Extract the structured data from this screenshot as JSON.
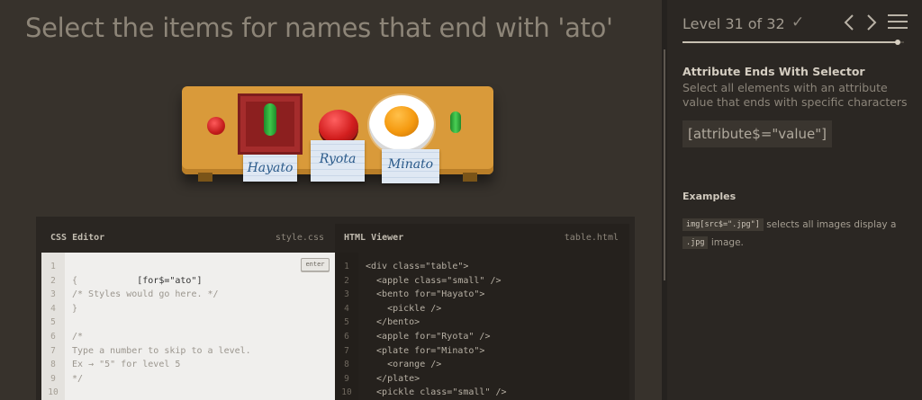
{
  "instruction": "Select the items for names that end with 'ato'",
  "table": {
    "name_tags": [
      "Hayato",
      "Ryota",
      "Minato"
    ]
  },
  "css_editor": {
    "title": "CSS Editor",
    "filename": "style.css",
    "enter_label": "enter",
    "input_value": "[for$=\"ato\"]",
    "line_numbers": [
      "1",
      "2",
      "3",
      "4",
      "5",
      "6",
      "7",
      "8",
      "9",
      "10"
    ],
    "lines": [
      "{",
      "/* Styles would go here. */",
      "}",
      "",
      "/*",
      "Type a number to skip to a level.",
      "Ex → \"5\" for level 5",
      "*/",
      ""
    ]
  },
  "html_viewer": {
    "title": "HTML Viewer",
    "filename": "table.html",
    "line_numbers": [
      "1",
      "2",
      "3",
      "4",
      "5",
      "6",
      "7",
      "8",
      "9",
      "10"
    ],
    "lines": [
      "<div class=\"table\">",
      "  <apple class=\"small\" />",
      "  <bento for=\"Hayato\">",
      "    <pickle />",
      "  </bento>",
      "  <apple for=\"Ryota\" />",
      "  <plate for=\"Minato\">",
      "    <orange />",
      "  </plate>",
      "  <pickle class=\"small\" />"
    ]
  },
  "sidebar": {
    "level_label": "Level 31 of 32",
    "progress_fraction": 0.97,
    "icons": {
      "check": "check-icon",
      "prev": "chevron-left-icon",
      "next": "chevron-right-icon",
      "menu": "hamburger-menu-icon"
    },
    "selector_name": "Attribute Ends With Selector",
    "selector_description": "Select all elements with an attribute value that ends with specific characters",
    "syntax": "[attribute$=\"value\"]",
    "examples_title": "Examples",
    "example": {
      "code": "img[src$=\".jpg\"]",
      "text": "selects all images display a",
      "code2": ".jpg",
      "text2": "image."
    }
  }
}
